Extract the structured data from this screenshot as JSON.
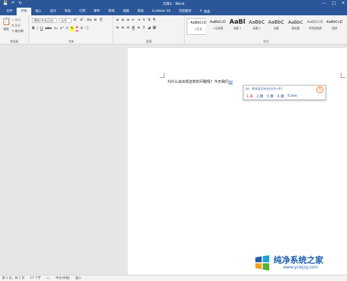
{
  "title_bar": {
    "title": "文档1 - Word",
    "qat": [
      "save-icon",
      "undo-icon",
      "redo-icon"
    ]
  },
  "tabs": {
    "items": [
      "文件",
      "开始",
      "插入",
      "设计",
      "布局",
      "引用",
      "邮件",
      "审阅",
      "视图",
      "帮助",
      "EndNote X8",
      "百度翻译"
    ],
    "active": "开始",
    "tell_me": "搜索"
  },
  "ribbon": {
    "clipboard": {
      "paste": "粘贴",
      "cut": "剪切",
      "copy": "复制",
      "format_painter": "格式刷",
      "label": "剪贴板"
    },
    "font": {
      "name": "等线 (中文正文)",
      "size": "五号",
      "label": "字体"
    },
    "paragraph": {
      "label": "段落"
    },
    "styles": {
      "label": "样式",
      "items": [
        {
          "preview": "AaBbCcD",
          "name": "↵正文"
        },
        {
          "preview": "AaBbCcD",
          "name": "↵无间隔"
        },
        {
          "preview": "AaBl",
          "name": "标题 1"
        },
        {
          "preview": "AaBbC",
          "name": "标题 2"
        },
        {
          "preview": "AaBbC",
          "name": "标题"
        },
        {
          "preview": "AaBbC",
          "name": "副标题"
        },
        {
          "preview": "AaBbCcD",
          "name": "不明显强调"
        },
        {
          "preview": "AaBbCcD",
          "name": "强调"
        }
      ]
    }
  },
  "document": {
    "text": "为什么会出现这样的问题呢？今天我们"
  },
  "ime": {
    "composition": "lai",
    "hint": "更多英文补全(分号+R)",
    "candidates": [
      "1.来",
      "2.赖",
      "3.莱",
      "4.濑",
      "5.lala"
    ],
    "nav": [
      "‹",
      "›"
    ]
  },
  "status_bar": {
    "page": "第 1 页，共 1 页",
    "words": "17 个字",
    "lang": "中文(中国)",
    "mode": "插入"
  },
  "watermark": {
    "title": "纯净系统之家",
    "url": "www.ycwjzy.com"
  }
}
